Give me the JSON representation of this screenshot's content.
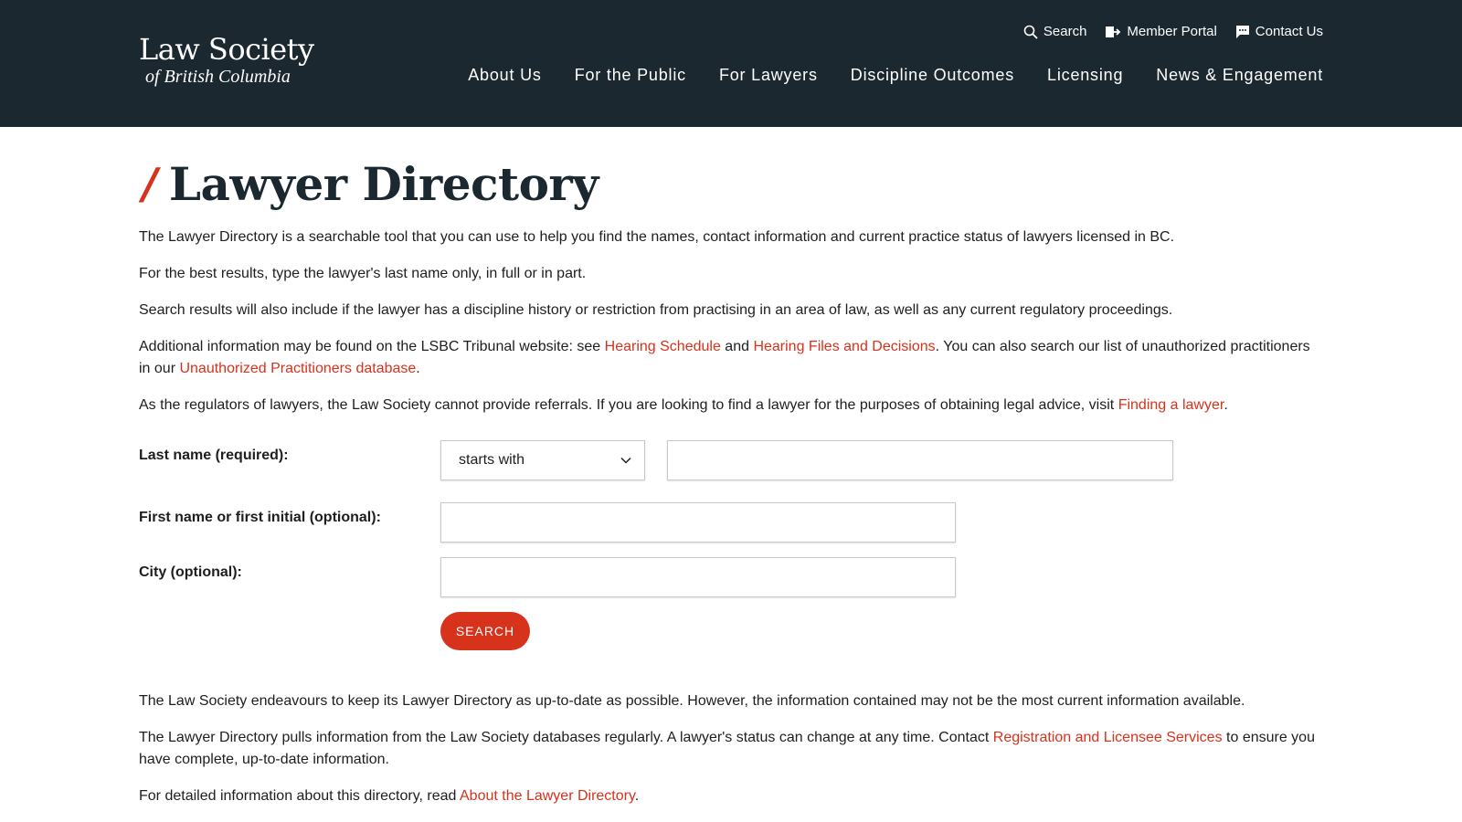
{
  "header": {
    "logo_main": "Law Society",
    "logo_sub": "of British Columbia",
    "utility": [
      {
        "label": "Search",
        "icon": "search-icon"
      },
      {
        "label": "Member Portal",
        "icon": "member-portal-icon"
      },
      {
        "label": "Contact Us",
        "icon": "chat-icon"
      }
    ],
    "nav": [
      "About Us",
      "For the Public",
      "For Lawyers",
      "Discipline Outcomes",
      "Licensing",
      "News & Engagement"
    ]
  },
  "page": {
    "slash": "/",
    "title": "Lawyer Directory"
  },
  "intro": {
    "p1": "The Lawyer Directory is a searchable tool that you can use to help you find the names, contact information and current practice status of lawyers licensed in BC.",
    "p2": "For the best results, type the lawyer's last name only, in full or in part.",
    "p3": "Search results will also include if the lawyer has a discipline history or restriction from practising in an area of law, as well as any current regulatory proceedings.",
    "p4_a": "Additional information may be found on the LSBC Tribunal website: see ",
    "p4_link1": "Hearing Schedule",
    "p4_b": " and ",
    "p4_link2": "Hearing Files and Decisions",
    "p4_c": ". You can also search our list of unauthorized practitioners in our ",
    "p4_link3": "Unauthorized Practitioners database",
    "p4_d": ".",
    "p5_a": "As the regulators of lawyers, the Law Society cannot provide referrals. If you are looking to find a lawyer for the purposes of obtaining legal advice, visit ",
    "p5_link": "Finding a lawyer",
    "p5_b": "."
  },
  "form": {
    "last_name_label": "Last name (required):",
    "match_select_value": "starts with",
    "last_name_value": "",
    "first_name_label": "First name or first initial (optional):",
    "first_name_value": "",
    "city_label": "City (optional):",
    "city_value": "",
    "search_button": "SEARCH"
  },
  "footer": {
    "p1": "The Law Society endeavours to keep its Lawyer Directory as up-to-date as possible. However, the information contained may not be the most current information available.",
    "p2_a": "The Lawyer Directory pulls information from the Law Society databases regularly. A lawyer's status can change at any time. Contact ",
    "p2_link": "Registration and Licensee Services",
    "p2_b": " to ensure you have complete, up-to-date information.",
    "p3_a": "For detailed information about this directory, read ",
    "p3_link": "About the Lawyer Directory",
    "p3_b": "."
  },
  "colors": {
    "header_bg": "#1c2830",
    "accent": "#d6321c"
  }
}
